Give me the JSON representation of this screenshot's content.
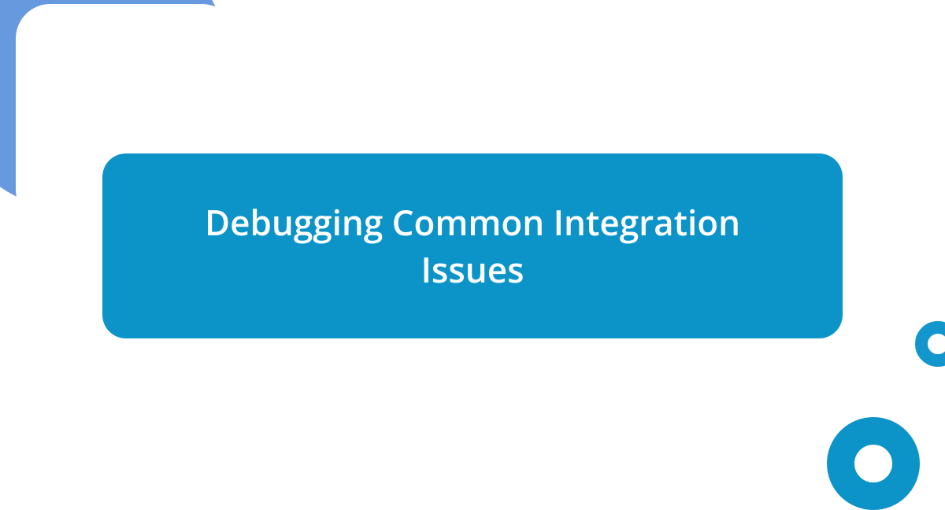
{
  "title": "Debugging Common Integration Issues",
  "colors": {
    "primary": "#0c94c9",
    "accent": "#6699dd",
    "background": "#ffffff",
    "text": "#ffffff"
  }
}
